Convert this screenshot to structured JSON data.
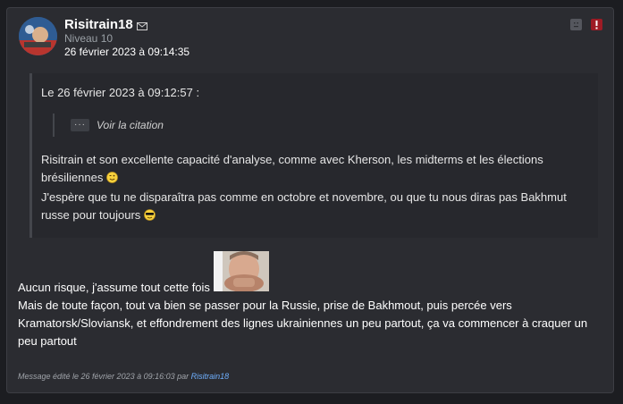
{
  "post": {
    "username": "Risitrain18",
    "level": "Niveau 10",
    "date": "26 février 2023 à 09:14:35",
    "icons": {
      "mail": "mail-icon",
      "neutral_action": "neutral-face-icon",
      "report": "exclamation-icon"
    }
  },
  "quote": {
    "header": "Le 26 février 2023 à 09:12:57 :",
    "nested_dots": "···",
    "see_quote": "Voir la citation",
    "line1": "Risitrain et son excellente capacité d'analyse, comme avec Kherson, les midterms et les élections brésiliennes",
    "line2": "J'espère que tu ne disparaîtra pas comme en octobre et novembre, ou que tu nous diras pas Bakhmut russe pour toujours"
  },
  "reply": {
    "line1": "Aucun risque, j'assume tout cette fois",
    "line2": "Mais de toute façon, tout va bien se passer pour la Russie, prise de Bakhmout, puis percée vers Kramatorsk/Sloviansk, et effondrement des lignes ukrainiennes un peu partout, ça va commencer à craquer un peu partout"
  },
  "footer": {
    "edited_prefix": "Message édité le 26 février 2023 à 09:16:03 par",
    "edited_author": "Risitrain18"
  },
  "colors": {
    "background": "#1c1d21",
    "card": "#2b2c31",
    "link": "#6fb0ff",
    "report": "#9e1b25"
  }
}
